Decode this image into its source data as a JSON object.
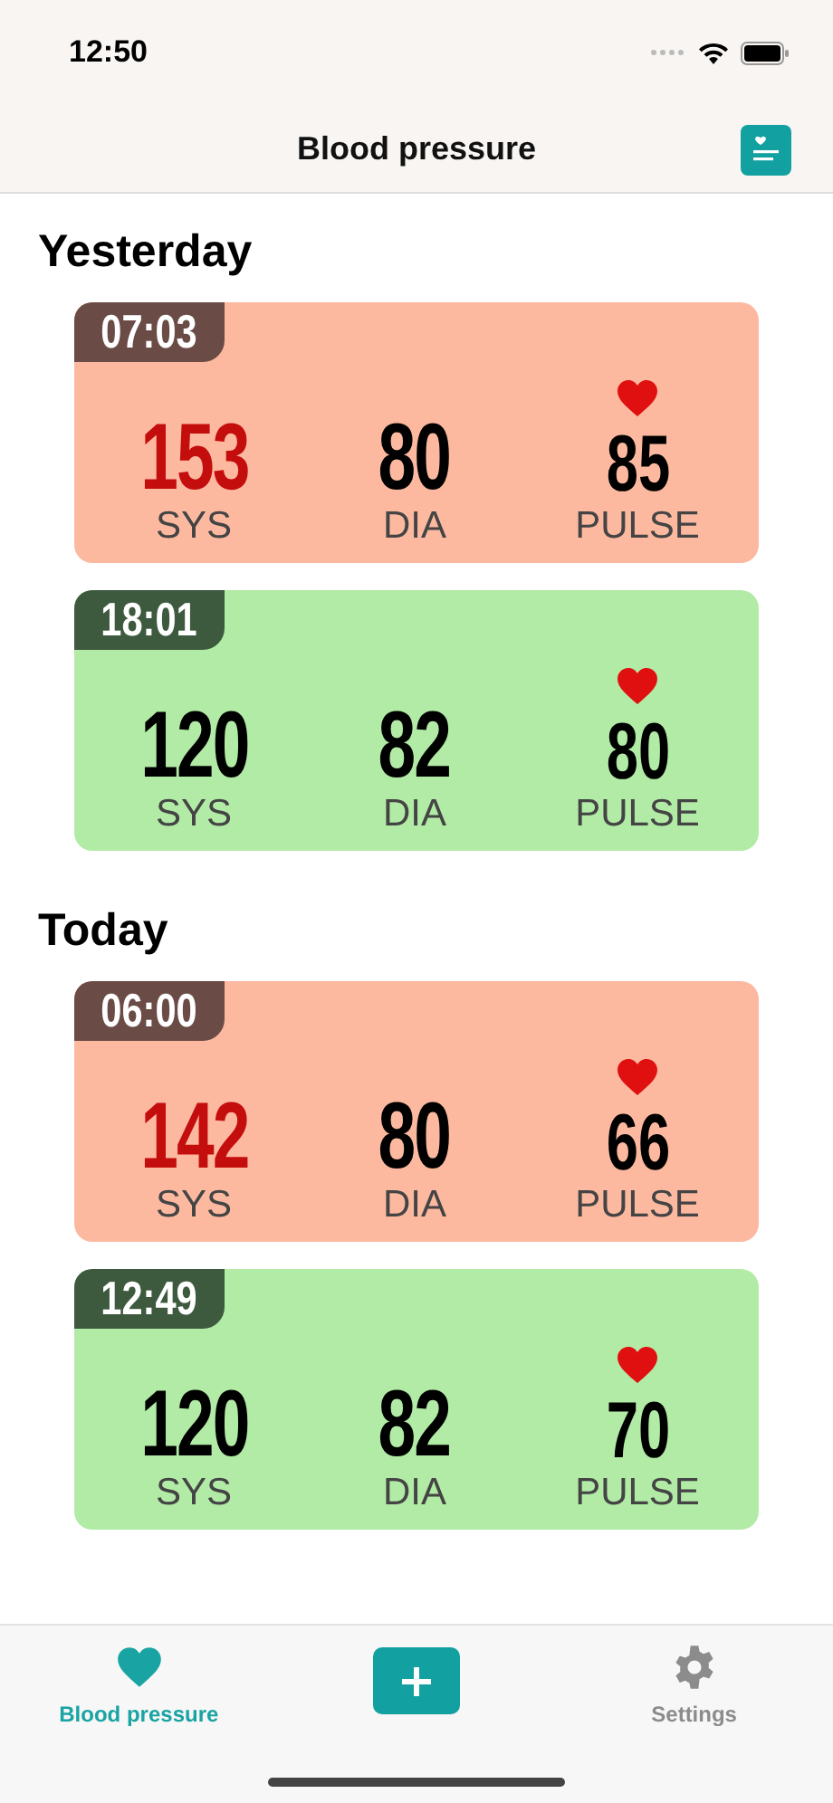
{
  "status_bar": {
    "time": "12:50"
  },
  "header": {
    "title": "Blood pressure"
  },
  "sections": [
    {
      "title": "Yesterday",
      "readings": [
        {
          "time": "07:03",
          "kind": "high",
          "sys": "153",
          "sys_label": "SYS",
          "dia": "80",
          "dia_label": "DIA",
          "pulse": "85",
          "pulse_label": "PULSE"
        },
        {
          "time": "18:01",
          "kind": "normal",
          "sys": "120",
          "sys_label": "SYS",
          "dia": "82",
          "dia_label": "DIA",
          "pulse": "80",
          "pulse_label": "PULSE"
        }
      ]
    },
    {
      "title": "Today",
      "readings": [
        {
          "time": "06:00",
          "kind": "high",
          "sys": "142",
          "sys_label": "SYS",
          "dia": "80",
          "dia_label": "DIA",
          "pulse": "66",
          "pulse_label": "PULSE"
        },
        {
          "time": "12:49",
          "kind": "normal",
          "sys": "120",
          "sys_label": "SYS",
          "dia": "82",
          "dia_label": "DIA",
          "pulse": "70",
          "pulse_label": "PULSE"
        }
      ]
    }
  ],
  "tab_bar": [
    {
      "kind": "heart",
      "label": "Blood pressure",
      "selected": true
    },
    {
      "kind": "add"
    },
    {
      "kind": "gear",
      "label": "Settings",
      "selected": false
    }
  ]
}
